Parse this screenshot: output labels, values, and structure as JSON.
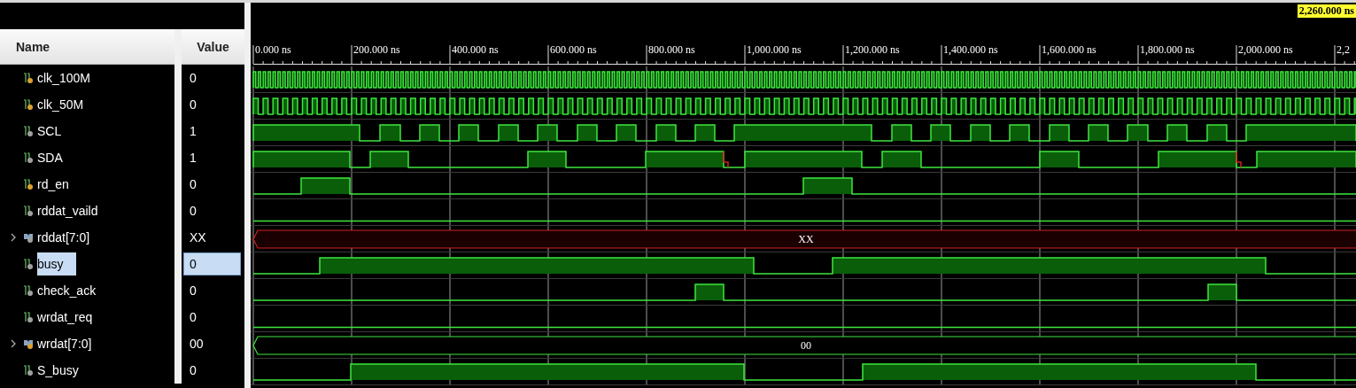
{
  "columns": [
    "Name",
    "Value"
  ],
  "cursor": {
    "time": "2,260.000 ns"
  },
  "time_axis": [
    "0.000 ns",
    "200.000 ns",
    "400.000 ns",
    "600.000 ns",
    "800.000 ns",
    "1,000.000 ns",
    "1,200.000 ns",
    "1,400.000 ns",
    "1,600.000 ns",
    "1,800.000 ns",
    "2,000.000 ns",
    "2,2"
  ],
  "signals": [
    {
      "name": "clk_100M",
      "value": "0",
      "kind": "bit",
      "color": "#d9a030",
      "selected": false
    },
    {
      "name": "clk_50M",
      "value": "0",
      "kind": "bit",
      "color": "#d9a030",
      "selected": false
    },
    {
      "name": "SCL",
      "value": "1",
      "kind": "bit",
      "color": "#a0a0a0",
      "selected": false
    },
    {
      "name": "SDA",
      "value": "1",
      "kind": "bit",
      "color": "#a0a0a0",
      "selected": false
    },
    {
      "name": "rd_en",
      "value": "0",
      "kind": "bit",
      "color": "#d9a030",
      "selected": false
    },
    {
      "name": "rddat_vaild",
      "value": "0",
      "kind": "bit",
      "color": "#a0a0a0",
      "selected": false
    },
    {
      "name": "rddat[7:0]",
      "value": "XX",
      "kind": "bus",
      "color": "#a0a0a0",
      "selected": false,
      "unknown": true,
      "wave_label": "XX"
    },
    {
      "name": "busy",
      "value": "0",
      "kind": "bit",
      "color": "#a0a0a0",
      "selected": true
    },
    {
      "name": "check_ack",
      "value": "0",
      "kind": "bit",
      "color": "#a0a0a0",
      "selected": false
    },
    {
      "name": "wrdat_req",
      "value": "0",
      "kind": "bit",
      "color": "#a0a0a0",
      "selected": false
    },
    {
      "name": "wrdat[7:0]",
      "value": "00",
      "kind": "bus",
      "color": "#d9a030",
      "selected": false,
      "unknown": false,
      "wave_label": "00"
    },
    {
      "name": "S_busy",
      "value": "0",
      "kind": "bit",
      "color": "#a0a0a0",
      "selected": false
    }
  ]
}
